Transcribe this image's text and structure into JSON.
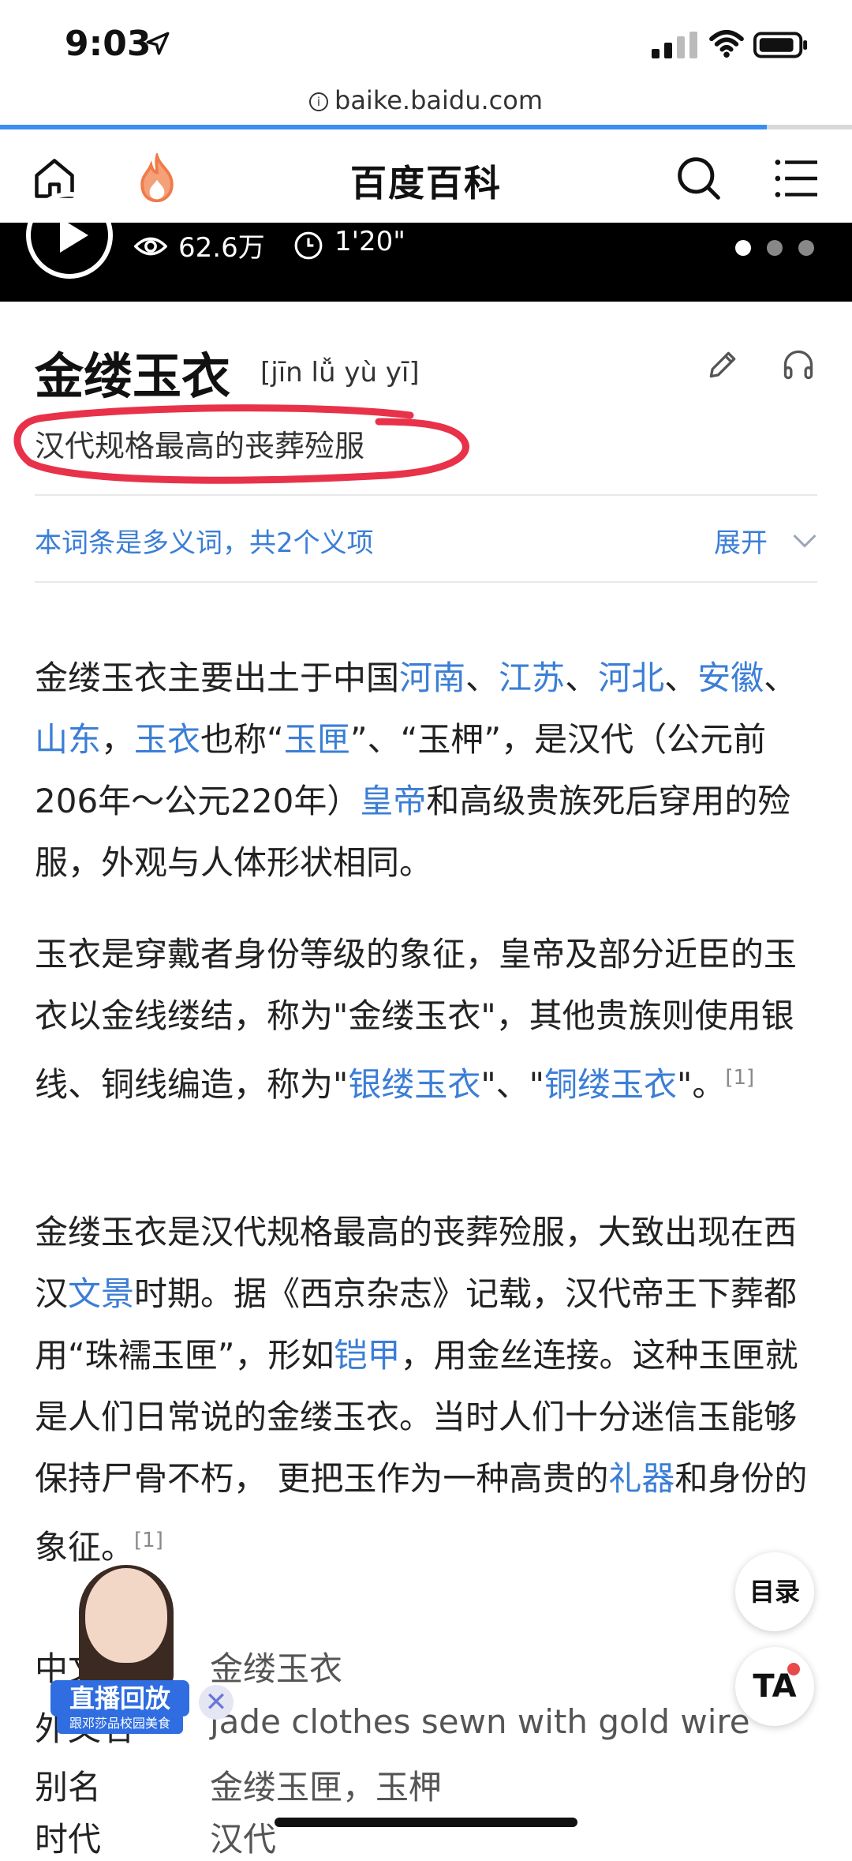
{
  "status": {
    "time": "9:03"
  },
  "browser": {
    "url": "baike.baidu.com",
    "load_progress": 0.9
  },
  "nav": {
    "brand": "百度百科"
  },
  "video": {
    "views": "62.6万",
    "duration": "1'20\""
  },
  "entry": {
    "title": "金缕玉衣",
    "pinyin": "[jīn lǚ yù yī]",
    "subtitle": "汉代规格最高的丧葬殓服",
    "polysemy": "本词条是多义词，共2个义项",
    "expand": "展开"
  },
  "paragraphs": {
    "p1": {
      "t1": "金缕玉衣主要出土于中国",
      "l1": "河南",
      "s1": "、",
      "l2": "江苏",
      "s2": "、",
      "l3": "河北",
      "s3": "、",
      "l4": "安徽",
      "s4": "、",
      "l5": "山东",
      "s5": "，",
      "l6": "玉衣",
      "t2": "也称“",
      "l7": "玉匣",
      "t3": "”、“玉柙”，是汉代（公元前206年～公元220年）",
      "l8": "皇帝",
      "t4": "和高级贵族死后穿用的殓服，外观与人体形状相同。"
    },
    "p2": {
      "t1": "玉衣是穿戴者身份等级的象征，皇帝及部分近臣的玉衣以金线缕结，称为\"金缕玉衣\"，其他贵族则使用银线、铜线编造，称为\"",
      "l1": "银缕玉衣",
      "t2": "\"、\"",
      "l2": "铜缕玉衣",
      "t3": "\"。",
      "ref": "[1]"
    },
    "p3": {
      "t1": "金缕玉衣是汉代规格最高的丧葬殓服，大致出现在西汉",
      "l1": "文景",
      "t2": "时期。据《西京杂志》记载，汉代帝王下葬都用“珠襦玉匣”，形如",
      "l2": "铠甲",
      "t3": "，用金丝连接。这种玉匣就是人们日常说的金缕玉衣。当时人们十分迷信玉能够保持尸骨不朽， 更把玉作为一种高贵的",
      "l3": "礼器",
      "t4": "和身份的象征。",
      "ref": "[1]"
    }
  },
  "infobox": [
    {
      "label": "中文名",
      "value": "金缕玉衣"
    },
    {
      "label": "外文名",
      "value": "jade clothes sewn with gold wire"
    },
    {
      "label": "别名",
      "value": "金缕玉匣，玉柙"
    },
    {
      "label": "时代",
      "value": "汉代"
    }
  ],
  "floating": {
    "toc": "目录",
    "ta": "TA"
  },
  "live": {
    "badge": "直播回放",
    "sub": "跟邓莎品校园美食",
    "close": "✕"
  },
  "colors": {
    "link": "#3b7ed6",
    "annotation": "#e8324a",
    "progress": "#3a8ef0"
  }
}
